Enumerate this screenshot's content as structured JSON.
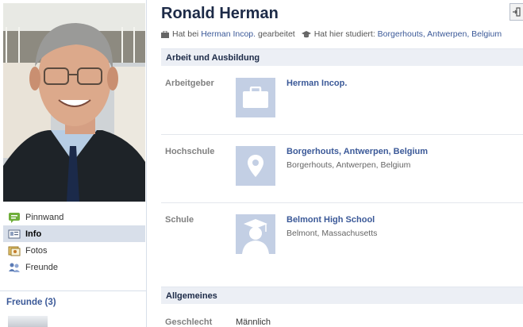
{
  "profile": {
    "name": "Ronald Herman",
    "worked_prefix": "Hat bei",
    "worked_company": "Herman Incop.",
    "worked_suffix": "gearbeitet",
    "studied_prefix": "Hat hier studiert:",
    "studied_place": "Borgerhouts, Antwerpen, Belgium"
  },
  "sidebar": {
    "nav": [
      {
        "label": "Pinnwand",
        "icon": "wall-icon"
      },
      {
        "label": "Info",
        "icon": "info-icon",
        "active": true
      },
      {
        "label": "Fotos",
        "icon": "photos-icon"
      },
      {
        "label": "Freunde",
        "icon": "friends-icon"
      }
    ],
    "friends_heading": "Freunde (3)"
  },
  "work_education": {
    "heading": "Arbeit und Ausbildung",
    "entries": [
      {
        "label": "Arbeitgeber",
        "title": "Herman Incop.",
        "subtitle": "",
        "icon": "briefcase-icon"
      },
      {
        "label": "Hochschule",
        "title": "Borgerhouts, Antwerpen, Belgium",
        "subtitle": "Borgerhouts, Antwerpen, Belgium",
        "icon": "map-pin-icon"
      },
      {
        "label": "Schule",
        "title": "Belmont High School",
        "subtitle": "Belmont, Massachusetts",
        "icon": "graduate-icon"
      }
    ]
  },
  "general": {
    "heading": "Allgemeines",
    "gender_label": "Geschlecht",
    "gender_value": "Männlich"
  },
  "colors": {
    "link": "#3b5998",
    "heading_bg": "#eceff5",
    "thumb_bg": "#c3cfe4"
  }
}
